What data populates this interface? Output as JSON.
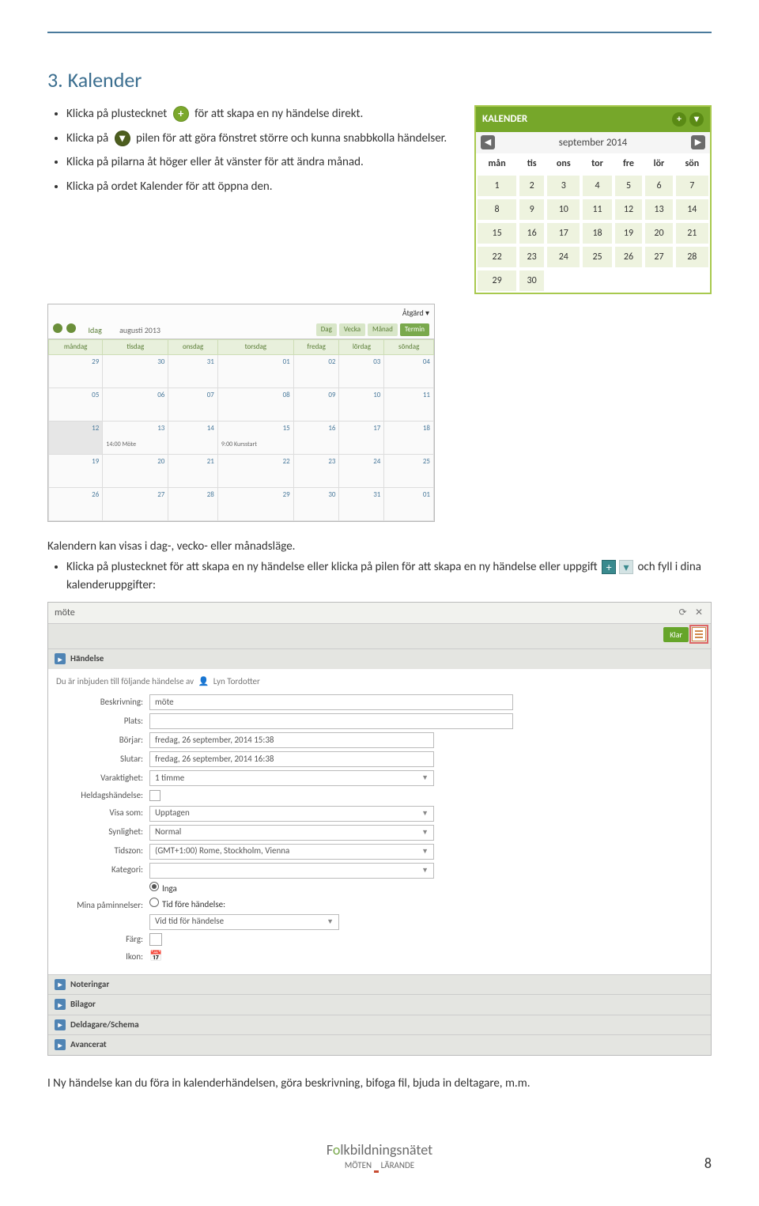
{
  "heading": "3. Kalender",
  "intro_bullets": {
    "b1a": "Klicka på plustecknet",
    "b1b": "för att skapa en ny händelse direkt.",
    "b2a": "Klicka på",
    "b2b": "pilen för att göra fönstret större och kunna snabbkolla händelser.",
    "b3": "Klicka på pilarna åt höger eller åt vänster för att ändra månad.",
    "b4": "Klicka på ordet Kalender för att öppna den."
  },
  "cal_widget": {
    "title": "KALENDER",
    "month": "september 2014",
    "days": [
      "mån",
      "tis",
      "ons",
      "tor",
      "fre",
      "lör",
      "sön"
    ],
    "rows": [
      [
        1,
        2,
        3,
        4,
        5,
        6,
        7
      ],
      [
        8,
        9,
        10,
        11,
        12,
        13,
        14
      ],
      [
        15,
        16,
        17,
        18,
        19,
        20,
        21
      ],
      [
        22,
        23,
        24,
        25,
        26,
        27,
        28
      ],
      [
        29,
        30,
        null,
        null,
        null,
        null,
        null
      ]
    ]
  },
  "month_grid": {
    "left_label": "Idag",
    "month": "augusti 2013",
    "action": "Åtgärd ▾",
    "view_btns": [
      "Dag",
      "Vecka",
      "Månad",
      "Termin"
    ],
    "active_view": 3,
    "day_headers": [
      "måndag",
      "tisdag",
      "onsdag",
      "torsdag",
      "fredag",
      "lördag",
      "söndag"
    ],
    "rows": [
      [
        "29",
        "30",
        "31",
        "01",
        "02",
        "03",
        "04"
      ],
      [
        "05",
        "06",
        "07",
        "08",
        "09",
        "10",
        "11"
      ],
      [
        "12",
        "13",
        "14",
        "15",
        "16",
        "17",
        "18"
      ],
      [
        "19",
        "20",
        "21",
        "22",
        "23",
        "24",
        "25"
      ],
      [
        "26",
        "27",
        "28",
        "29",
        "30",
        "31",
        "01"
      ]
    ],
    "events": {
      "r2c1": "14:00 Möte",
      "r2c3": "9:00 Kursstart"
    }
  },
  "mid_text": {
    "p1": "Kalendern kan visas i dag-, vecko- eller månadsläge.",
    "b1a": "Klicka på plustecknet för att skapa en ny händelse eller klicka på pilen för att skapa en ny händelse eller uppgift",
    "b1b": "och fyll i dina kalenderuppgifter:"
  },
  "event_form": {
    "tab_title": "möte",
    "save_btn": "Klar",
    "section_event": "Händelse",
    "invite_pre": "Du är inbjuden till följande händelse av",
    "invite_person": "Lyn Tordotter",
    "desc_label": "Beskrivning:",
    "desc_value": "möte",
    "place_label": "Plats:",
    "start_label": "Börjar:",
    "start_value": "fredag, 26 september, 2014 15:38",
    "end_label": "Slutar:",
    "end_value": "fredag, 26 september, 2014 16:38",
    "dur_label": "Varaktighet:",
    "dur_value": "1 timme",
    "allday_label": "Heldagshändelse:",
    "showas_label": "Visa som:",
    "showas_value": "Upptagen",
    "vis_label": "Synlighet:",
    "vis_value": "Normal",
    "tz_label": "Tidszon:",
    "tz_value": "(GMT+1:00) Rome, Stockholm, Vienna",
    "cat_label": "Kategori:",
    "rem_label": "Mina påminnelser:",
    "rem_none": "Inga",
    "rem_before": "Tid före händelse:",
    "rem_at": "Vid tid för händelse",
    "color_label": "Färg:",
    "icon_label": "Ikon:",
    "sections": [
      "Noteringar",
      "Bilagor",
      "Deldagare/Schema",
      "Avancerat"
    ]
  },
  "closing": "I Ny händelse kan du föra in kalenderhändelsen, göra beskrivning, bifoga fil, bjuda in deltagare, m.m.",
  "footer": {
    "brand_pre": "F",
    "brand_mid": "lkbildningsnätet",
    "sub1": "MÖTEN",
    "sub2": "LÄRANDE"
  },
  "page_number": "8"
}
